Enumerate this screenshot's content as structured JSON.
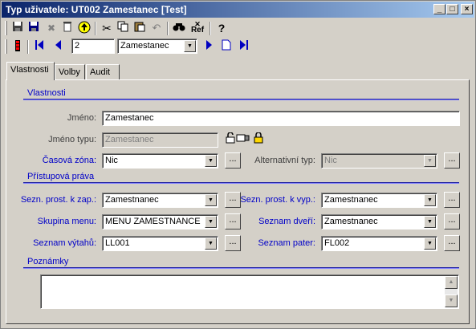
{
  "window": {
    "title": "Typ uživatele: UT002 Zamestanec [Test]",
    "controls": [
      "_",
      "□",
      "×"
    ]
  },
  "toolbar": {
    "record_number": "2",
    "record_select": "Zamestanec",
    "ref_label_top": "✕",
    "ref_label": "Ref"
  },
  "tabs": [
    {
      "label": "Vlastnosti",
      "active": true
    },
    {
      "label": "Volby",
      "active": false
    },
    {
      "label": "Audit",
      "active": false
    }
  ],
  "sections": {
    "vlastnosti": "Vlastnosti",
    "pristupova_prava": "Přístupová práva",
    "poznamky": "Poznámky"
  },
  "fields": {
    "jmeno": {
      "label": "Jméno:",
      "value": "Zamestanec"
    },
    "jmeno_typu": {
      "label": "Jméno typu:",
      "value": "Zamestanec"
    },
    "casova_zona": {
      "label": "Časová zóna:",
      "value": "Nic"
    },
    "alternativni_typ": {
      "label": "Alternativní typ:",
      "value": "Nic"
    },
    "sezn_prost_zap": {
      "label": "Sezn. prost. k zap.:",
      "value": "Zamestnanec"
    },
    "sezn_prost_vyp": {
      "label": "Sezn. prost. k vyp.:",
      "value": "Zamestnanec"
    },
    "skupina_menu": {
      "label": "Skupina menu:",
      "value": "MENU ZAMESTNANCE"
    },
    "seznam_dveri": {
      "label": "Seznam dveří:",
      "value": "Zamestnanec"
    },
    "seznam_vytahu": {
      "label": "Seznam výtahů:",
      "value": "LL001"
    },
    "seznam_pater": {
      "label": "Seznam pater:",
      "value": "FL002"
    }
  },
  "browse_label": "...",
  "colors": {
    "title_start": "#0a246a",
    "title_end": "#a6caf0",
    "label_blue": "#0000c8",
    "face": "#d4d0c8"
  }
}
